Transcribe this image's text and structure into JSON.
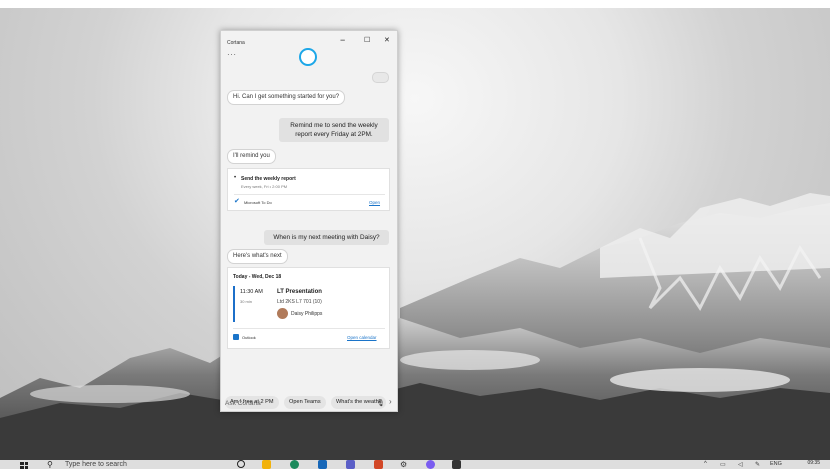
{
  "window": {
    "title": "Cortana",
    "more_label": "···",
    "minimize": "−",
    "maximize": "☐",
    "close": "✕"
  },
  "conversation": {
    "greeting": "Hi. Can I get something started for you?",
    "user_msg_1": "Remind me to send the weekly report every Friday at 2PM.",
    "reply_1": "I'll remind you",
    "reminder_card": {
      "title": "Send the weekly report",
      "subtitle": "Every week, Fri • 2:00 PM",
      "app": "Microsoft To Do",
      "action": "Open"
    },
    "user_msg_2": "When is my next meeting with Daisy?",
    "reply_2": "Here's what's next",
    "meeting_card": {
      "date": "Today - Wed, Dec 18",
      "time": "11:30 AM",
      "duration": "30 min",
      "title": "LT Presentation",
      "location": "Ltd 2KS L7 701 (10)",
      "attendee": "Daisy Philipps",
      "app": "Outlook",
      "action": "Open calendar"
    }
  },
  "suggestions": [
    "Am I free at 2 PM",
    "Open Teams",
    "What's the weathe"
  ],
  "suggestions_next": "›",
  "ask": {
    "placeholder": "Ask Cortana"
  },
  "taskbar": {
    "search_placeholder": "Type here to search",
    "tray": {
      "lang": "ENG",
      "time": "09:35"
    }
  },
  "colors": {
    "accent": "#1da7e8",
    "link": "#1a74c9",
    "calendar_bar": "#1c6fc9"
  }
}
